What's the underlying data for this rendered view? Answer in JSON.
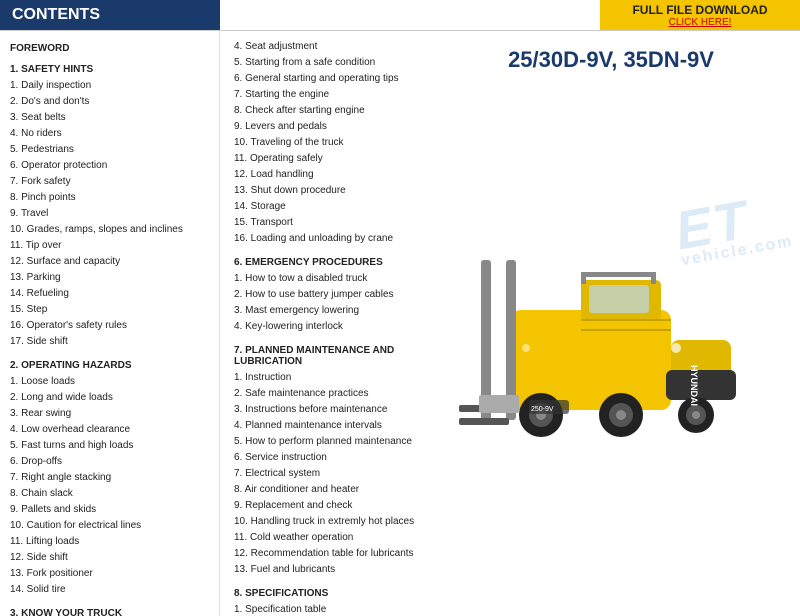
{
  "header": {
    "contents_label": "CONTENTS",
    "download_title": "FULL FILE DOWNLOAD",
    "download_sub": "CLICK HERE!"
  },
  "left_col": {
    "foreword": "FOREWORD",
    "sections": [
      {
        "title": "1. SAFETY HINTS",
        "items": [
          "1. Daily inspection",
          "2. Do's and don'ts",
          "3. Seat belts",
          "4. No riders",
          "5. Pedestrians",
          "6. Operator protection",
          "7. Fork safety",
          "8. Pinch points",
          "9. Travel",
          "10. Grades, ramps, slopes and inclines",
          "11. Tip over",
          "12. Surface and capacity",
          "13. Parking",
          "14. Refueling",
          "15. Step",
          "16. Operator's safety rules",
          "17. Side shift"
        ]
      },
      {
        "title": "2. OPERATING HAZARDS",
        "items": [
          "1. Loose loads",
          "2. Long and wide loads",
          "3. Rear swing",
          "4. Low overhead clearance",
          "5. Fast turns and high loads",
          "6. Drop-offs",
          "7. Right angle stacking",
          "8. Chain slack",
          "9. Pallets and skids",
          "10. Caution for electrical lines",
          "11. Lifting loads",
          "12. Side shift",
          "13. Fork positioner",
          "14. Solid tire"
        ]
      },
      {
        "title": "3. KNOW YOUR TRUCK",
        "items": []
      }
    ]
  },
  "right_col": {
    "continuing_items": [
      "4. Seat adjustment",
      "5. Starting from a safe condition",
      "6. General starting and operating tips",
      "7. Starting the engine",
      "8. Check after starting engine",
      "9. Levers and pedals",
      "10. Traveling of the truck",
      "11. Operating safely",
      "12. Load handling",
      "13. Shut down procedure",
      "14. Storage",
      "15. Transport",
      "16. Loading and unloading by crane"
    ],
    "sections": [
      {
        "title": "6. EMERGENCY PROCEDURES",
        "items": [
          "1. How to tow a disabled truck",
          "2. How to use battery jumper cables",
          "3. Mast emergency lowering",
          "4. Key-lowering interlock"
        ]
      },
      {
        "title": "7. PLANNED MAINTENANCE AND LUBRICATION",
        "items": [
          "1. Instruction",
          "2. Safe maintenance practices",
          "3. Instructions before maintenance",
          "4. Planned maintenance intervals",
          "5. How to perform planned maintenance",
          "6. Service instruction",
          "7. Electrical system",
          "8. Air conditioner and heater",
          "9. Replacement and check",
          "10. Handling truck in extremly hot places",
          "11. Cold weather operation",
          "12. Recommendation table for lubricants",
          "13. Fuel and lubricants"
        ]
      },
      {
        "title": "8. SPECIFICATIONS",
        "items": [
          "1. Specification table"
        ]
      }
    ],
    "model": "25/30D-9V, 35DN-9V",
    "watermark_lines": [
      "ET",
      "vehicle.com"
    ]
  }
}
